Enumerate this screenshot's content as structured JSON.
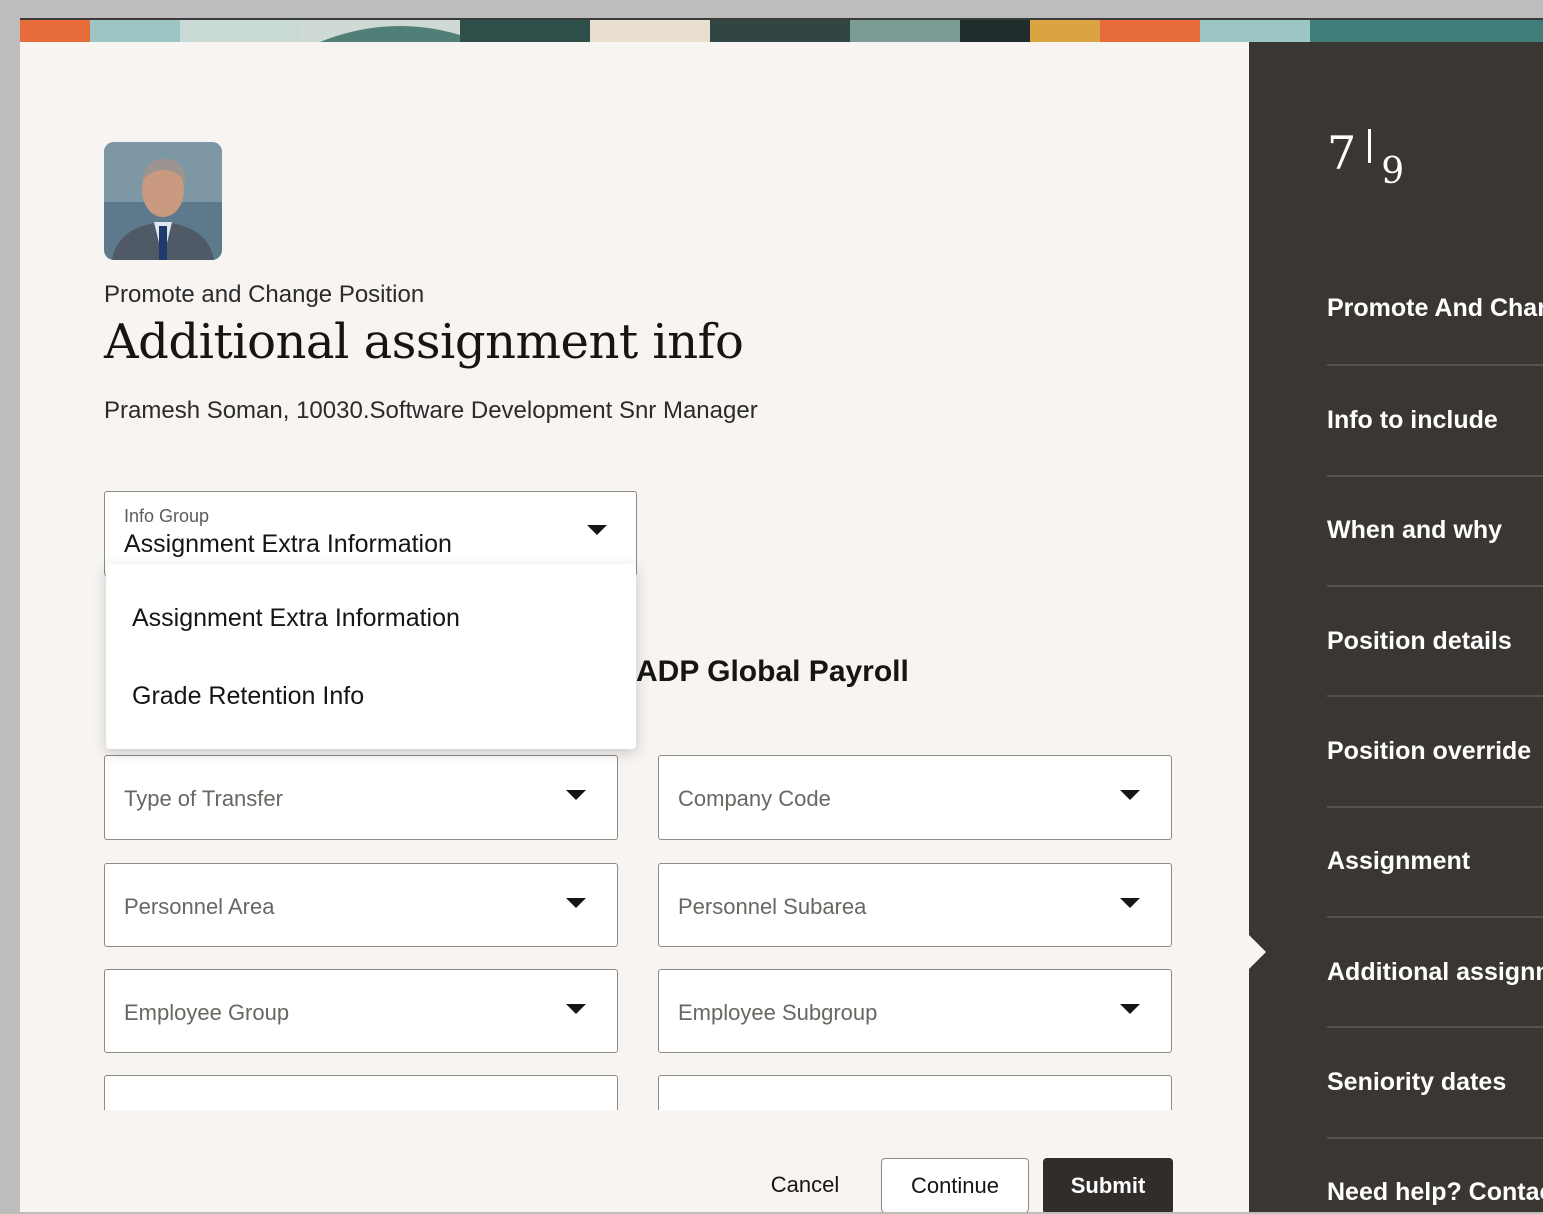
{
  "header": {
    "eyebrow": "Promote and Change Position",
    "title": "Additional assignment info",
    "subtitle": "Pramesh Soman, 10030.Software Development Snr Manager"
  },
  "info_group": {
    "label": "Info Group",
    "value": "Assignment Extra Information",
    "options": [
      "Assignment Extra Information",
      "Grade Retention Info"
    ]
  },
  "section": {
    "title": "ADP Global Payroll"
  },
  "fields": {
    "type_of_transfer": "Type of Transfer",
    "company_code": "Company Code",
    "personnel_area": "Personnel Area",
    "personnel_subarea": "Personnel Subarea",
    "employee_group": "Employee Group",
    "employee_subgroup": "Employee Subgroup"
  },
  "actions": {
    "cancel": "Cancel",
    "continue": "Continue",
    "submit": "Submit"
  },
  "sidebar": {
    "current_step": "7",
    "total_steps": "9",
    "steps": [
      "Promote And Change Position",
      "Info to include",
      "When and why",
      "Position details",
      "Position override",
      "Assignment",
      "Additional assignment info",
      "Seniority dates",
      "Need help? Contact"
    ],
    "active_step_index": 6
  },
  "colors": {
    "sidebar_bg": "#3a3631",
    "page_bg": "#f7f4f2",
    "submit_bg": "#312d2a",
    "accent_orange": "#e86c3a",
    "accent_teal": "#3f7d78"
  }
}
